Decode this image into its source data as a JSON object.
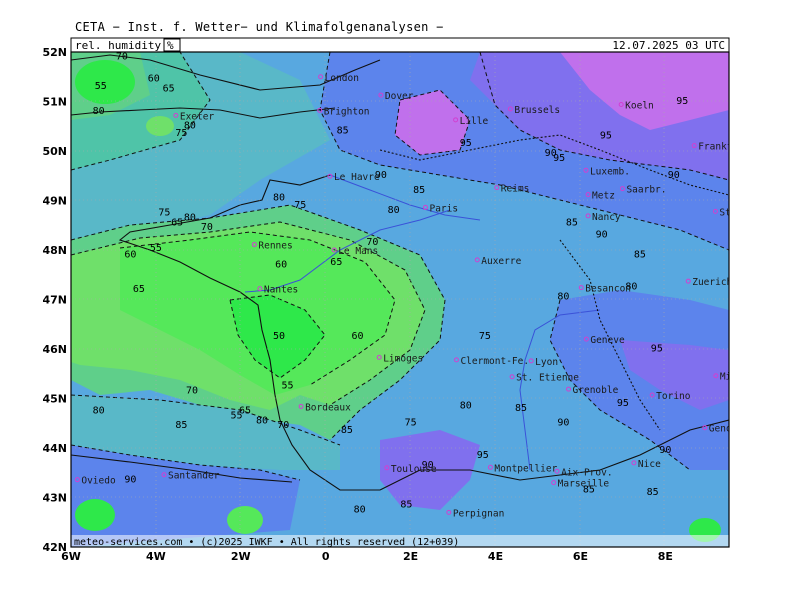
{
  "header": {
    "title": "CETA − Inst. f. Wetter− und Klimafolgenanalysen −",
    "parameter": "rel. humidity",
    "unit": "%",
    "valid_time": "12.07.2025 03 UTC"
  },
  "footer": {
    "copyright": "meteo-services.com • (c)2025 IWKF • All rights reserved (12+039)"
  },
  "map": {
    "parameter": "relative humidity",
    "unit": "%",
    "lon_range": [
      -6,
      9.5
    ],
    "lat_range": [
      42,
      52
    ],
    "lon_ticks": [
      "6W",
      "4W",
      "2W",
      "0",
      "2E",
      "4E",
      "6E",
      "8E"
    ],
    "lat_ticks": [
      "42N",
      "43N",
      "44N",
      "45N",
      "46N",
      "47N",
      "48N",
      "49N",
      "50N",
      "51N",
      "52N"
    ],
    "colors": {
      "rh_55": "#2ee84a",
      "rh_60": "#55e85a",
      "rh_65": "#6fe06a",
      "rh_70": "#5fcf8a",
      "rh_75": "#4fc4a8",
      "rh_80": "#59b8c8",
      "rh_85": "#58a8e0",
      "rh_90": "#5c84ec",
      "rh_95": "#8070ee",
      "rh_100": "#c070ec",
      "coast": "#101010",
      "river": "#3a52d8",
      "city_marker": "#d040d0"
    },
    "cities": [
      {
        "name": "Dover",
        "lon": 1.3,
        "lat": 51.13
      },
      {
        "name": "Lille",
        "lon": 3.06,
        "lat": 50.63
      },
      {
        "name": "Brussels",
        "lon": 4.35,
        "lat": 50.85
      },
      {
        "name": "Koeln",
        "lon": 6.96,
        "lat": 50.94
      },
      {
        "name": "Frankfurt",
        "lon": 8.68,
        "lat": 50.11
      },
      {
        "name": "Le Havre",
        "lon": 0.1,
        "lat": 49.49
      },
      {
        "name": "Reims",
        "lon": 4.03,
        "lat": 49.26
      },
      {
        "name": "Luxemb.",
        "lon": 6.13,
        "lat": 49.61
      },
      {
        "name": "Metz",
        "lon": 6.18,
        "lat": 49.12
      },
      {
        "name": "Saarbr.",
        "lon": 6.99,
        "lat": 49.24
      },
      {
        "name": "Paris",
        "lon": 2.35,
        "lat": 48.86
      },
      {
        "name": "Nancy",
        "lon": 6.18,
        "lat": 48.69
      },
      {
        "name": "Stuttgart",
        "lon": 9.18,
        "lat": 48.78
      },
      {
        "name": "Rennes",
        "lon": -1.68,
        "lat": 48.11
      },
      {
        "name": "Le Mans",
        "lon": 0.2,
        "lat": 48.0
      },
      {
        "name": "Auxerre",
        "lon": 3.57,
        "lat": 47.8
      },
      {
        "name": "Nantes",
        "lon": -1.55,
        "lat": 47.22
      },
      {
        "name": "Besancon",
        "lon": 6.02,
        "lat": 47.24
      },
      {
        "name": "Zuerich",
        "lon": 8.54,
        "lat": 47.37
      },
      {
        "name": "Geneve",
        "lon": 6.14,
        "lat": 46.2
      },
      {
        "name": "Limoges",
        "lon": 1.26,
        "lat": 45.83
      },
      {
        "name": "Clermont-Fe.",
        "lon": 3.08,
        "lat": 45.78
      },
      {
        "name": "Lyon",
        "lon": 4.84,
        "lat": 45.76
      },
      {
        "name": "St. Etienne",
        "lon": 4.39,
        "lat": 45.44
      },
      {
        "name": "Milano",
        "lon": 9.19,
        "lat": 45.46
      },
      {
        "name": "Grenoble",
        "lon": 5.72,
        "lat": 45.19
      },
      {
        "name": "Bordeaux",
        "lon": -0.58,
        "lat": 44.84
      },
      {
        "name": "Torino",
        "lon": 7.69,
        "lat": 45.07
      },
      {
        "name": "Genova",
        "lon": 8.93,
        "lat": 44.41
      },
      {
        "name": "Nice",
        "lon": 7.26,
        "lat": 43.7
      },
      {
        "name": "Montpellier",
        "lon": 3.88,
        "lat": 43.61
      },
      {
        "name": "Toulouse",
        "lon": 1.44,
        "lat": 43.6
      },
      {
        "name": "Aix-Prov.",
        "lon": 5.45,
        "lat": 43.53
      },
      {
        "name": "Marseille",
        "lon": 5.37,
        "lat": 43.3
      },
      {
        "name": "Perpignan",
        "lon": 2.9,
        "lat": 42.7
      },
      {
        "name": "Santander",
        "lon": -3.81,
        "lat": 43.46
      },
      {
        "name": "Oviedo",
        "lon": -5.85,
        "lat": 43.36
      },
      {
        "name": "Exeter",
        "lon": -3.53,
        "lat": 50.72
      },
      {
        "name": "Brighton",
        "lon": -0.14,
        "lat": 50.82
      },
      {
        "name": "London",
        "lon": -0.12,
        "lat": 51.5
      }
    ],
    "contour_labels": [
      {
        "value": "70",
        "lon": -4.8,
        "lat": 51.85
      },
      {
        "value": "55",
        "lon": -5.3,
        "lat": 51.25
      },
      {
        "value": "60",
        "lon": -4.05,
        "lat": 51.4
      },
      {
        "value": "65",
        "lon": -3.7,
        "lat": 51.2
      },
      {
        "value": "80",
        "lon": -5.35,
        "lat": 50.75
      },
      {
        "value": "80",
        "lon": -3.2,
        "lat": 50.45
      },
      {
        "value": "75",
        "lon": -3.4,
        "lat": 50.3
      },
      {
        "value": "85",
        "lon": 0.4,
        "lat": 50.35
      },
      {
        "value": "90",
        "lon": 1.3,
        "lat": 49.45
      },
      {
        "value": "95",
        "lon": 3.3,
        "lat": 50.1
      },
      {
        "value": "90",
        "lon": 5.3,
        "lat": 49.9
      },
      {
        "value": "95",
        "lon": 5.5,
        "lat": 49.8
      },
      {
        "value": "95",
        "lon": 6.6,
        "lat": 50.25
      },
      {
        "value": "95",
        "lon": 8.4,
        "lat": 50.95
      },
      {
        "value": "90",
        "lon": 8.2,
        "lat": 49.45
      },
      {
        "value": "85",
        "lon": 2.2,
        "lat": 49.15
      },
      {
        "value": "80",
        "lon": -1.1,
        "lat": 49.0
      },
      {
        "value": "75",
        "lon": -0.6,
        "lat": 48.85
      },
      {
        "value": "80",
        "lon": 1.6,
        "lat": 48.75
      },
      {
        "value": "75",
        "lon": -3.8,
        "lat": 48.7
      },
      {
        "value": "80",
        "lon": -3.2,
        "lat": 48.6
      },
      {
        "value": "65",
        "lon": -3.5,
        "lat": 48.5
      },
      {
        "value": "70",
        "lon": -2.8,
        "lat": 48.4
      },
      {
        "value": "55",
        "lon": -4.0,
        "lat": 47.98
      },
      {
        "value": "60",
        "lon": -4.6,
        "lat": 47.85
      },
      {
        "value": "65",
        "lon": -4.4,
        "lat": 47.15
      },
      {
        "value": "70",
        "lon": 1.1,
        "lat": 48.1
      },
      {
        "value": "65",
        "lon": 0.25,
        "lat": 47.7
      },
      {
        "value": "60",
        "lon": -1.05,
        "lat": 47.65
      },
      {
        "value": "85",
        "lon": 5.8,
        "lat": 48.5
      },
      {
        "value": "90",
        "lon": 6.5,
        "lat": 48.25
      },
      {
        "value": "85",
        "lon": 7.4,
        "lat": 47.85
      },
      {
        "value": "80",
        "lon": 5.6,
        "lat": 47.0
      },
      {
        "value": "80",
        "lon": 7.2,
        "lat": 47.2
      },
      {
        "value": "95",
        "lon": 7.8,
        "lat": 45.95
      },
      {
        "value": "75",
        "lon": 3.75,
        "lat": 46.2
      },
      {
        "value": "60",
        "lon": 0.75,
        "lat": 46.2
      },
      {
        "value": "50",
        "lon": -1.1,
        "lat": 46.2
      },
      {
        "value": "55",
        "lon": -0.9,
        "lat": 45.2
      },
      {
        "value": "70",
        "lon": -3.15,
        "lat": 45.1
      },
      {
        "value": "80",
        "lon": -5.35,
        "lat": 44.7
      },
      {
        "value": "85",
        "lon": -3.4,
        "lat": 44.4
      },
      {
        "value": "85",
        "lon": 0.5,
        "lat": 44.3
      },
      {
        "value": "80",
        "lon": 3.3,
        "lat": 44.8
      },
      {
        "value": "75",
        "lon": 2.0,
        "lat": 44.45
      },
      {
        "value": "85",
        "lon": 4.6,
        "lat": 44.75
      },
      {
        "value": "90",
        "lon": 5.6,
        "lat": 44.45
      },
      {
        "value": "95",
        "lon": 7.0,
        "lat": 44.85
      },
      {
        "value": "90",
        "lon": 8.0,
        "lat": 43.9
      },
      {
        "value": "95",
        "lon": 3.7,
        "lat": 43.8
      },
      {
        "value": "90",
        "lon": 2.4,
        "lat": 43.6
      },
      {
        "value": "90",
        "lon": -4.6,
        "lat": 43.3
      },
      {
        "value": "85",
        "lon": 6.2,
        "lat": 43.1
      },
      {
        "value": "85",
        "lon": 7.7,
        "lat": 43.05
      },
      {
        "value": "80",
        "lon": 0.8,
        "lat": 42.7
      },
      {
        "value": "85",
        "lon": 1.9,
        "lat": 42.8
      },
      {
        "value": "70",
        "lon": -1.0,
        "lat": 44.4
      },
      {
        "value": "65",
        "lon": -1.9,
        "lat": 44.7
      },
      {
        "value": "55",
        "lon": -2.1,
        "lat": 44.6
      },
      {
        "value": "80",
        "lon": -1.5,
        "lat": 44.5
      }
    ]
  }
}
